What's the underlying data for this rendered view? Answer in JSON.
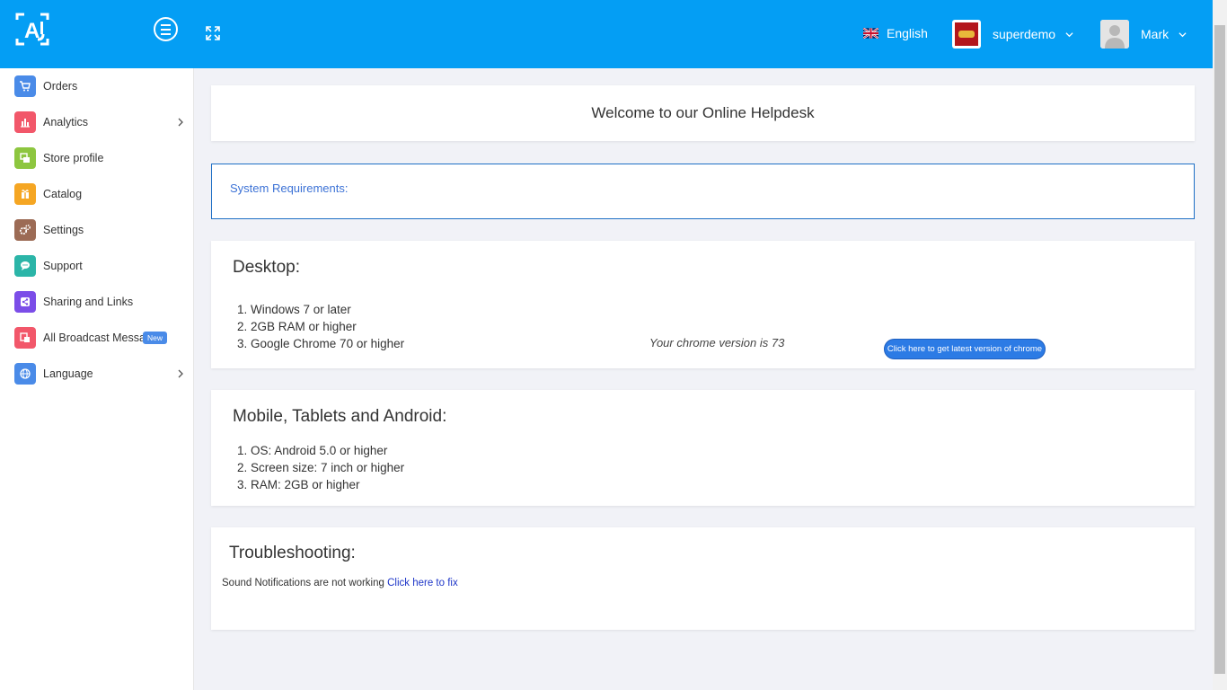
{
  "header": {
    "language": "English",
    "store_name": "superdemo",
    "user_name": "Mark"
  },
  "sidebar": {
    "items": [
      {
        "label": "Orders",
        "icon": "cart-icon",
        "color": "#4a8be8"
      },
      {
        "label": "Analytics",
        "icon": "bar-chart-icon",
        "color": "#f2576a"
      },
      {
        "label": "Store profile",
        "icon": "store-icon",
        "color": "#8dc63f"
      },
      {
        "label": "Catalog",
        "icon": "gift-icon",
        "color": "#f5a623"
      },
      {
        "label": "Settings",
        "icon": "gears-icon",
        "color": "#9c6b55"
      },
      {
        "label": "Support",
        "icon": "chat-icon",
        "color": "#2bb5a8"
      },
      {
        "label": "Sharing and Links",
        "icon": "share-icon",
        "color": "#7b4de8"
      },
      {
        "label": "All Broadcast Messages",
        "icon": "broadcast-icon",
        "color": "#f2576a",
        "badge": "New"
      },
      {
        "label": "Language",
        "icon": "globe-icon",
        "color": "#4a8be8"
      }
    ]
  },
  "main": {
    "welcome": "Welcome to our Online Helpdesk",
    "system_requirements": "System Requirements:",
    "desktop": {
      "title": "Desktop:",
      "items": [
        "1. Windows 7 or later",
        "2. 2GB RAM or higher",
        "3. Google Chrome 70 or higher"
      ],
      "chrome_version": "Your chrome version is 73",
      "chrome_button": "Click here to get latest version of chrome"
    },
    "mobile": {
      "title": "Mobile, Tablets and Android:",
      "items": [
        "1. OS: Android 5.0 or higher",
        "2. Screen size: 7 inch or higher",
        "3. RAM: 2GB or higher"
      ]
    },
    "troubleshooting": {
      "title": "Troubleshooting:",
      "sound_text": "Sound Notifications are not working",
      "fix_link": "Click here to fix"
    }
  }
}
